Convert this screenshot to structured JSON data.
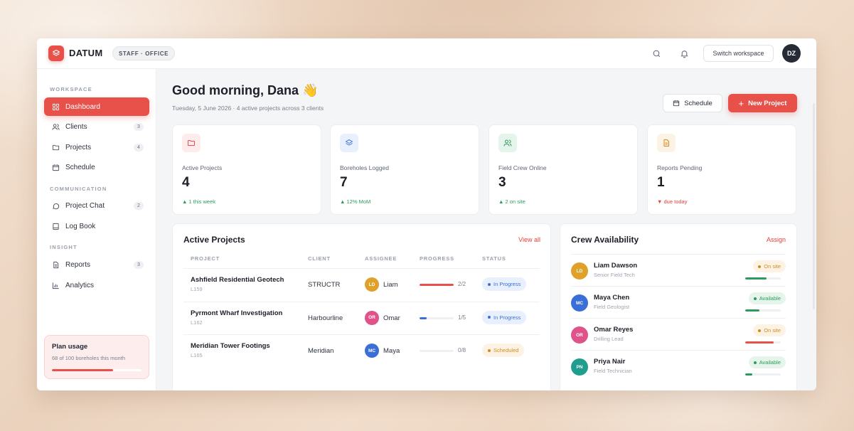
{
  "brand": {
    "name": "DATUM",
    "env": "STAFF · OFFICE"
  },
  "topbar": {
    "switch_label": "Switch workspace",
    "avatar_initials": "DZ"
  },
  "sidebar": {
    "sections": {
      "workspace": "WORKSPACE",
      "communication": "COMMUNICATION",
      "insight": "INSIGHT"
    },
    "items": [
      {
        "label": "Dashboard",
        "icon": "grid-icon",
        "count": ""
      },
      {
        "label": "Clients",
        "icon": "users-icon",
        "count": "3"
      },
      {
        "label": "Projects",
        "icon": "folder-icon",
        "count": "4"
      },
      {
        "label": "Schedule",
        "icon": "calendar-icon",
        "count": ""
      },
      {
        "label": "Project Chat",
        "icon": "chat-icon",
        "count": "2"
      },
      {
        "label": "Log Book",
        "icon": "book-icon",
        "count": ""
      },
      {
        "label": "Reports",
        "icon": "document-icon",
        "count": "3"
      },
      {
        "label": "Analytics",
        "icon": "bar-chart-icon",
        "count": ""
      }
    ],
    "plan": {
      "title": "Plan usage",
      "subtitle": "68 of 100 boreholes this month",
      "used_fraction": 0.68
    }
  },
  "header": {
    "greeting": "Good morning, Dana 👋",
    "subtitle": "Tuesday, 5 June 2026 · 4 active projects across 3 clients",
    "schedule_label": "Schedule",
    "new_project_label": "New Project"
  },
  "stats": [
    {
      "label": "Active Projects",
      "value": "4",
      "trend": "▲ 1 this week",
      "dir": "up",
      "icon": "folder-icon",
      "color": "#e8504a",
      "bg": "#fdeceb"
    },
    {
      "label": "Boreholes Logged",
      "value": "7",
      "trend": "▲ 12% MoM",
      "dir": "up",
      "icon": "layers-icon",
      "color": "#3b6fd8",
      "bg": "#e9f0fd"
    },
    {
      "label": "Field Crew Online",
      "value": "3",
      "trend": "▲ 2 on site",
      "dir": "up",
      "icon": "users-icon",
      "color": "#2e9a5b",
      "bg": "#e6f5ec"
    },
    {
      "label": "Reports Pending",
      "value": "1",
      "trend": "▼ due today",
      "dir": "down",
      "icon": "document-icon",
      "color": "#d48a1e",
      "bg": "#fdf3e4"
    }
  ],
  "projects_panel": {
    "title": "Active Projects",
    "link": "View all",
    "columns": [
      "PROJECT",
      "CLIENT",
      "ASSIGNEE",
      "PROGRESS",
      "STATUS"
    ],
    "rows": [
      {
        "name": "Ashfield Residential Geotech",
        "code": "L159",
        "client": "STRUCTR",
        "initials": "LD",
        "assignee": "Liam",
        "av_color": "#e0a12a",
        "progress": 1.0,
        "bar_color": "#e8504a",
        "fraction": "2/2",
        "status": "In Progress",
        "status_type": "prog"
      },
      {
        "name": "Pyrmont Wharf Investigation",
        "code": "L162",
        "client": "Harbourline",
        "initials": "OR",
        "assignee": "Omar",
        "av_color": "#e0528a",
        "progress": 0.2,
        "bar_color": "#3b6fd8",
        "fraction": "1/5",
        "status": "In Progress",
        "status_type": "prog"
      },
      {
        "name": "Meridian Tower Footings",
        "code": "L165",
        "client": "Meridian",
        "initials": "MC",
        "assignee": "Maya",
        "av_color": "#3b6fd8",
        "progress": 0.0,
        "bar_color": "#3b6fd8",
        "fraction": "0/8",
        "status": "Scheduled",
        "status_type": "sched"
      }
    ]
  },
  "crew_panel": {
    "title": "Crew Availability",
    "link": "Assign",
    "members": [
      {
        "initials": "LD",
        "name": "Liam Dawson",
        "role": "Senior Field Tech",
        "status": "On site",
        "status_type": "onsite",
        "av_color": "#e0a12a",
        "load": 0.6,
        "bar_color": "#2e9a5b"
      },
      {
        "initials": "MC",
        "name": "Maya Chen",
        "role": "Field Geologist",
        "status": "Available",
        "status_type": "avail",
        "av_color": "#3b6fd8",
        "load": 0.4,
        "bar_color": "#2e9a5b"
      },
      {
        "initials": "OR",
        "name": "Omar Reyes",
        "role": "Drilling Lead",
        "status": "On site",
        "status_type": "onsite",
        "av_color": "#e0528a",
        "load": 0.8,
        "bar_color": "#e8504a"
      },
      {
        "initials": "PN",
        "name": "Priya Nair",
        "role": "Field Technician",
        "status": "Available",
        "status_type": "avail",
        "av_color": "#1f9e8f",
        "load": 0.2,
        "bar_color": "#2e9a5b"
      }
    ]
  }
}
